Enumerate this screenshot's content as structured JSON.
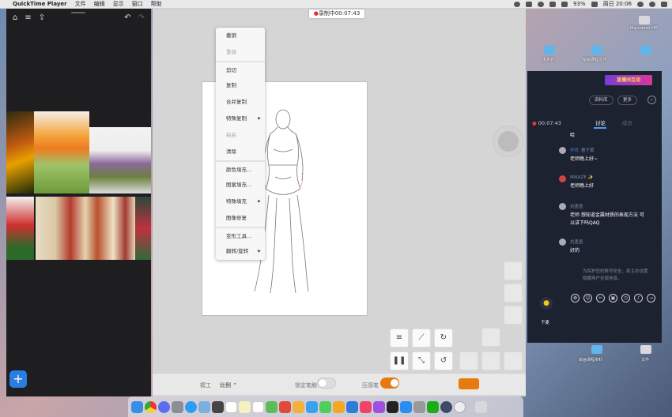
{
  "menubar": {
    "app_name": "QuickTime Player",
    "menus": [
      "文件",
      "编辑",
      "显示",
      "窗口",
      "帮助"
    ],
    "battery": "93%",
    "clock": "周日 20:06"
  },
  "recording": {
    "label": "录制中00:07:43"
  },
  "context_menu": {
    "items": [
      {
        "label": "撤销",
        "enabled": true,
        "submenu": false,
        "sep": false
      },
      {
        "label": "重做",
        "enabled": false,
        "submenu": false,
        "sep": false
      },
      {
        "label": "剪切",
        "enabled": true,
        "submenu": false,
        "sep": true
      },
      {
        "label": "复制",
        "enabled": true,
        "submenu": false,
        "sep": false
      },
      {
        "label": "合并复制",
        "enabled": true,
        "submenu": false,
        "sep": false
      },
      {
        "label": "特殊复制",
        "enabled": true,
        "submenu": true,
        "sep": false
      },
      {
        "label": "粘贴",
        "enabled": false,
        "submenu": false,
        "sep": false
      },
      {
        "label": "清除",
        "enabled": true,
        "submenu": false,
        "sep": false
      },
      {
        "label": "颜色填充...",
        "enabled": true,
        "submenu": false,
        "sep": true
      },
      {
        "label": "图案填充...",
        "enabled": true,
        "submenu": false,
        "sep": false
      },
      {
        "label": "特殊填充",
        "enabled": true,
        "submenu": true,
        "sep": false
      },
      {
        "label": "图像修复",
        "enabled": true,
        "submenu": false,
        "sep": false
      },
      {
        "label": "变形工具...",
        "enabled": true,
        "submenu": false,
        "sep": true
      },
      {
        "label": "翻转/旋转",
        "enabled": true,
        "submenu": true,
        "sep": false
      }
    ]
  },
  "bottom_bar": {
    "width_label": "模工",
    "ratio_label": "比例 ⌃",
    "toggle1_label": "锁定笔触",
    "toggle2_label": "压感笔"
  },
  "desktop": {
    "icons": [
      {
        "label": "Macintosh HD"
      },
      {
        "label": "未命名"
      },
      {
        "label": "绘画课程文件"
      }
    ],
    "bottom_icons": [
      {
        "label": "绘画课程资料"
      },
      {
        "label": "文件"
      }
    ]
  },
  "live_panel": {
    "banner": "直播间互动",
    "btn_material": "资料库",
    "btn_more": "更多",
    "timer": "00:07:43",
    "tab_discuss": "讨论",
    "tab_other": "成员",
    "first_line": "哈",
    "messages": [
      {
        "tag": "学员",
        "name": "橙子黄",
        "text": "老师晚上好~"
      },
      {
        "tag": "",
        "name": "MIKAZE ✨",
        "text": "老师晚上好"
      },
      {
        "tag": "",
        "name": "抗墨墨",
        "text": "老师 想知道金属材质的表现方法 可以讲下吗QAQ"
      },
      {
        "tag": "",
        "name": "抗墨墨",
        "text": "好的"
      }
    ],
    "notice": "为保护您的账号安全，部主办设置隐藏用户全部信息。",
    "mic_label": "下麦"
  },
  "colors": {
    "accent_orange": "#e8790f",
    "accent_blue": "#2a7de1",
    "panel_dark": "#1c2230"
  }
}
